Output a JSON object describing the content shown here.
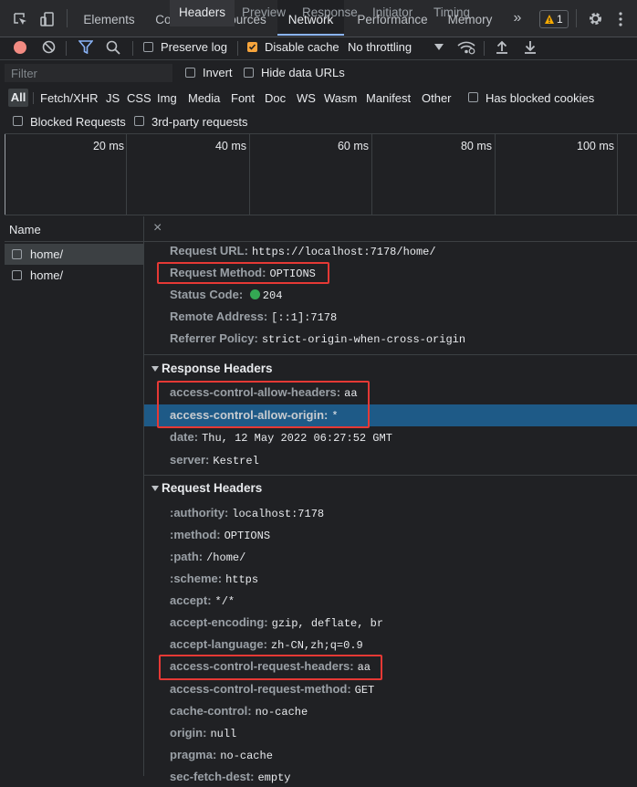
{
  "toolbar_top": {
    "tabs": [
      "Elements",
      "Console",
      "Sources",
      "Network",
      "Performance",
      "Memory"
    ],
    "active_tab": "Network",
    "more_label": "»",
    "warning_count": "1"
  },
  "toolbar": {
    "preserve_log": "Preserve log",
    "disable_cache": "Disable cache",
    "throttling": "No throttling"
  },
  "filter": {
    "placeholder": "Filter",
    "invert": "Invert",
    "hide_data_urls": "Hide data URLs",
    "types": [
      "All",
      "Fetch/XHR",
      "JS",
      "CSS",
      "Img",
      "Media",
      "Font",
      "Doc",
      "WS",
      "Wasm",
      "Manifest",
      "Other"
    ],
    "has_blocked_cookies": "Has blocked cookies",
    "blocked_requests": "Blocked Requests",
    "third_party": "3rd-party requests"
  },
  "timeline": {
    "ticks": [
      "20 ms",
      "40 ms",
      "60 ms",
      "80 ms",
      "100 ms"
    ]
  },
  "request_list": {
    "header": "Name",
    "items": [
      "home/",
      "home/"
    ]
  },
  "detail": {
    "close": "×",
    "tabs": [
      "Headers",
      "Preview",
      "Response",
      "Initiator",
      "Timing"
    ],
    "general": [
      {
        "k": "Request URL:",
        "v": "https://localhost:7178/home/"
      },
      {
        "k": "Request Method:",
        "v": "OPTIONS"
      },
      {
        "k": "Status Code:",
        "v": "204"
      },
      {
        "k": "Remote Address:",
        "v": "[::1]:7178"
      },
      {
        "k": "Referrer Policy:",
        "v": "strict-origin-when-cross-origin"
      }
    ],
    "response_title": "Response Headers",
    "response": [
      {
        "k": "access-control-allow-headers:",
        "v": "aa"
      },
      {
        "k": "access-control-allow-origin:",
        "v": "*"
      },
      {
        "k": "date:",
        "v": "Thu, 12 May 2022 06:27:52 GMT"
      },
      {
        "k": "server:",
        "v": "Kestrel"
      }
    ],
    "request_title": "Request Headers",
    "request": [
      {
        "k": ":authority:",
        "v": "localhost:7178"
      },
      {
        "k": ":method:",
        "v": "OPTIONS"
      },
      {
        "k": ":path:",
        "v": "/home/"
      },
      {
        "k": ":scheme:",
        "v": "https"
      },
      {
        "k": "accept:",
        "v": "*/*"
      },
      {
        "k": "accept-encoding:",
        "v": "gzip, deflate, br"
      },
      {
        "k": "accept-language:",
        "v": "zh-CN,zh;q=0.9"
      },
      {
        "k": "access-control-request-headers:",
        "v": "aa"
      },
      {
        "k": "access-control-request-method:",
        "v": "GET"
      },
      {
        "k": "cache-control:",
        "v": "no-cache"
      },
      {
        "k": "origin:",
        "v": "null"
      },
      {
        "k": "pragma:",
        "v": "no-cache"
      },
      {
        "k": "sec-fetch-dest:",
        "v": "empty"
      }
    ]
  },
  "colors": {
    "status_ok": "#34a853",
    "highlight_box": "#e53935",
    "selected_row": "#1e5a87"
  }
}
